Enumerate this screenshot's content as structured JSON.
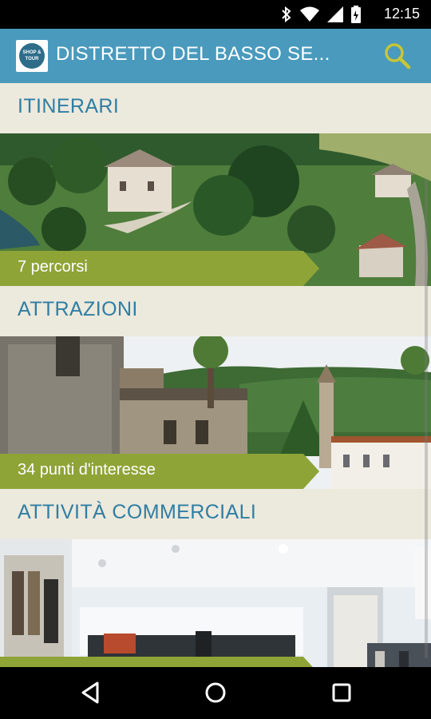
{
  "status_bar": {
    "time": "12:15",
    "icons": [
      "bluetooth-icon",
      "wifi-icon",
      "signal-icon",
      "battery-icon"
    ]
  },
  "app_bar": {
    "logo_text": "SHOP & TOUR",
    "title": "DISTRETTO DEL BASSO SE...",
    "search_icon": "search-icon",
    "background": "#4a9abd",
    "accent": "#c7c635"
  },
  "sections": [
    {
      "title": "ITINERARI",
      "count_label": "7 percorsi"
    },
    {
      "title": "ATTRAZIONI",
      "count_label": "34 punti d'interesse"
    },
    {
      "title": "ATTIVITÀ COMMERCIALI",
      "count_label": ""
    }
  ],
  "nav_bar": {
    "back_icon": "back-icon",
    "home_icon": "home-icon",
    "recents_icon": "recents-icon"
  },
  "colors": {
    "section_title": "#2f7ea3",
    "ribbon": "#8ea437",
    "background": "#ece9dd"
  }
}
